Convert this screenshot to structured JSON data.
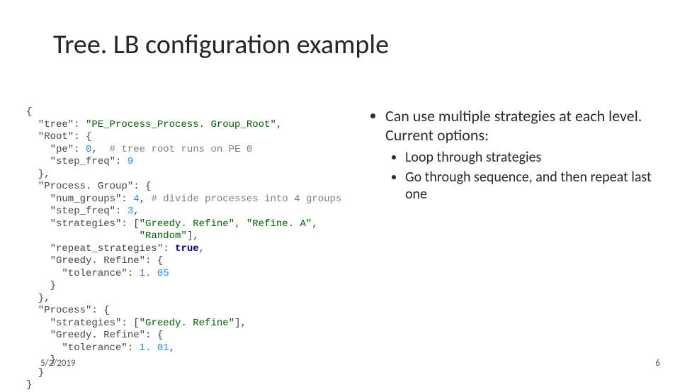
{
  "title": "Tree. LB configuration example",
  "bullets": {
    "main": "Can use multiple strategies at each level. Current options:",
    "sub1": "Loop through strategies",
    "sub2": "Go through sequence, and then repeat last one"
  },
  "code": {
    "l01a": "{",
    "l02a": "  \"tree\": ",
    "l02b": "\"PE_Process_Process. Group_Root\"",
    "l02c": ",",
    "l03a": "  \"Root\": {",
    "l04a": "    \"pe\": ",
    "l04b": "0",
    "l04c": ",  ",
    "l04d": "# tree root runs on PE 0",
    "l05a": "    \"step_freq\": ",
    "l05b": "9",
    "l06a": "  },",
    "l07a": "  \"Process. Group\": {",
    "l08a": "    \"num_groups\": ",
    "l08b": "4",
    "l08c": ", ",
    "l08d": "# divide processes into 4 groups",
    "l09a": "    \"step_freq\": ",
    "l09b": "3",
    "l09c": ",",
    "l10a": "    \"strategies\": [",
    "l10b": "\"Greedy. Refine\"",
    "l10c": ", ",
    "l10d": "\"Refine. A\"",
    "l10e": ",",
    "l11a": "                   ",
    "l11b": "\"Random\"",
    "l11c": "],",
    "l12a": "    \"repeat_strategies\": ",
    "l12b": "true",
    "l12c": ",",
    "l13a": "    \"Greedy. Refine\": {",
    "l14a": "      \"tolerance\": ",
    "l14b": "1. 05",
    "l15a": "    }",
    "l16a": "  },",
    "l17a": "  \"Process\": {",
    "l18a": "    \"strategies\": [",
    "l18b": "\"Greedy. Refine\"",
    "l18c": "],",
    "l19a": "    \"Greedy. Refine\": {",
    "l20a": "      \"tolerance\": ",
    "l20b": "1. 01",
    "l20c": ",",
    "l21a": "    }",
    "l22a": "  }",
    "l23a": "}"
  },
  "footer": {
    "date": "5/2/2019",
    "page": "6"
  }
}
